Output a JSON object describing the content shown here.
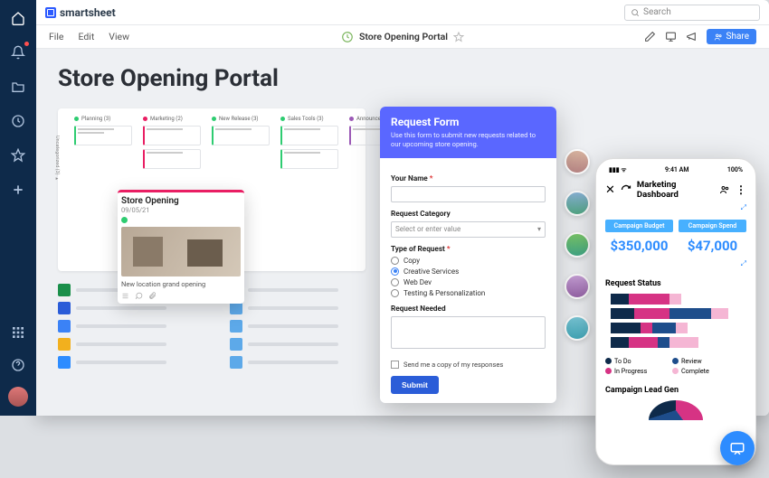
{
  "brand": "smartsheet",
  "search": {
    "placeholder": "Search"
  },
  "menubar": {
    "file": "File",
    "edit": "Edit",
    "view": "View"
  },
  "doc": {
    "title": "Store Opening Portal"
  },
  "share_label": "Share",
  "portal": {
    "title": "Store Opening Portal"
  },
  "board": {
    "columns": [
      {
        "label": "Planning (3)",
        "color": "#2ecc71"
      },
      {
        "label": "Marketing (2)",
        "color": "#e91e63"
      },
      {
        "label": "New Release (3)",
        "color": "#2ecc71"
      },
      {
        "label": "Sales Tools (3)",
        "color": "#2ecc71"
      },
      {
        "label": "Announcements",
        "color": "#9b59b6"
      }
    ]
  },
  "card": {
    "title": "Store Opening",
    "date": "09/05/21",
    "caption": "New location grand opening"
  },
  "form": {
    "title": "Request Form",
    "subtitle": "Use this form to submit new requests related to our upcoming store opening.",
    "name_label": "Your Name",
    "category_label": "Request Category",
    "category_placeholder": "Select or enter value",
    "type_label": "Type of Request",
    "types": [
      "Copy",
      "Creative Services",
      "Web Dev",
      "Testing & Personalization"
    ],
    "selected_type": "Creative Services",
    "needed_label": "Request Needed",
    "send_copy": "Send me a copy of my responses",
    "submit": "Submit"
  },
  "mobile": {
    "time": "9:41 AM",
    "battery": "100%",
    "title": "Marketing Dashboard",
    "metric1_label": "Campaign Budget",
    "metric1_value": "$350,000",
    "metric2_label": "Campaign Spend",
    "metric2_value": "$47,000",
    "status_title": "Request Status",
    "legend": {
      "todo": "To Do",
      "inprogress": "In Progress",
      "review": "Review",
      "complete": "Complete"
    },
    "section2": "Campaign Lead Gen"
  },
  "chart_data": {
    "type": "bar",
    "orientation": "horizontal",
    "title": "Request Status",
    "series_order": [
      "To Do",
      "In Progress",
      "Review",
      "Complete"
    ],
    "colors": {
      "To Do": "#0e2a4a",
      "In Progress": "#d63384",
      "Review": "#1e4d8b",
      "Complete": "#f5b6d4"
    },
    "rows": [
      {
        "To Do": 15,
        "In Progress": 35,
        "Review": 0,
        "Complete": 10
      },
      {
        "To Do": 20,
        "In Progress": 30,
        "Review": 35,
        "Complete": 15
      },
      {
        "To Do": 25,
        "In Progress": 10,
        "Review": 20,
        "Complete": 10
      },
      {
        "To Do": 15,
        "In Progress": 25,
        "Review": 10,
        "Complete": 25
      }
    ],
    "xlim": [
      0,
      100
    ]
  }
}
